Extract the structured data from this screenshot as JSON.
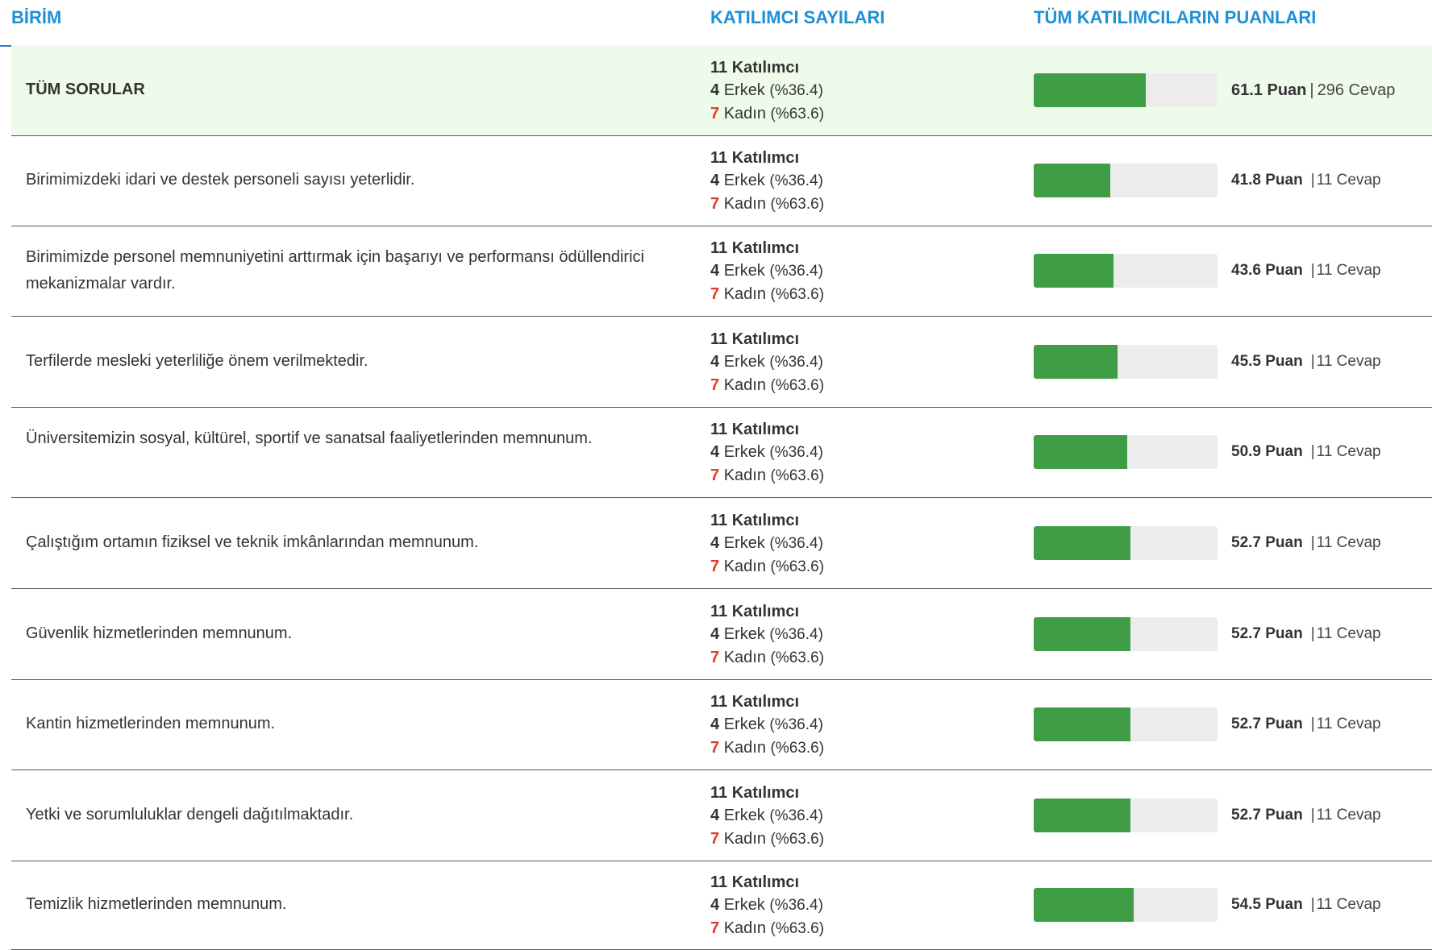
{
  "headers": {
    "birim": "BİRİM",
    "katilimci": "KATILIMCI SAYILARI",
    "puan": "TÜM KATILIMCILARIN PUANLARI"
  },
  "rows": [
    {
      "question": "TÜM SORULAR",
      "participants": "11 Katılımcı",
      "male_count": "4",
      "male_label": "Erkek",
      "male_pct": "(%36.4)",
      "female_count": "7",
      "female_label": "Kadın",
      "female_pct": "(%63.6)",
      "score": "61.1 Puan",
      "answers": "296 Cevap",
      "score_value": 61.1
    },
    {
      "question": "Birimimizdeki idari ve destek personeli sayısı yeterlidir.",
      "participants": "11 Katılımcı",
      "male_count": "4",
      "male_label": "Erkek",
      "male_pct": "(%36.4)",
      "female_count": "7",
      "female_label": "Kadın",
      "female_pct": "(%63.6)",
      "score": "41.8 Puan",
      "answers": "11 Cevap",
      "score_value": 41.8
    },
    {
      "question": "Birimimizde personel memnuniyetini arttırmak için başarıyı ve performansı ödüllendirici mekanizmalar vardır.",
      "participants": "11 Katılımcı",
      "male_count": "4",
      "male_label": "Erkek",
      "male_pct": "(%36.4)",
      "female_count": "7",
      "female_label": "Kadın",
      "female_pct": "(%63.6)",
      "score": "43.6 Puan",
      "answers": "11 Cevap",
      "score_value": 43.6
    },
    {
      "question": "Terfilerde mesleki yeterliliğe önem verilmektedir.",
      "participants": "11 Katılımcı",
      "male_count": "4",
      "male_label": "Erkek",
      "male_pct": "(%36.4)",
      "female_count": "7",
      "female_label": "Kadın",
      "female_pct": "(%63.6)",
      "score": "45.5 Puan",
      "answers": "11 Cevap",
      "score_value": 45.5
    },
    {
      "question": "Üniversitemizin sosyal, kültürel, sportif ve sanatsal faaliyetlerinden memnunum.",
      "participants": "11 Katılımcı",
      "male_count": "4",
      "male_label": "Erkek",
      "male_pct": "(%36.4)",
      "female_count": "7",
      "female_label": "Kadın",
      "female_pct": "(%63.6)",
      "score": "50.9 Puan",
      "answers": "11 Cevap",
      "score_value": 50.9
    },
    {
      "question": "Çalıştığım ortamın fiziksel ve teknik imkânlarından memnunum.",
      "participants": "11 Katılımcı",
      "male_count": "4",
      "male_label": "Erkek",
      "male_pct": "(%36.4)",
      "female_count": "7",
      "female_label": "Kadın",
      "female_pct": "(%63.6)",
      "score": "52.7 Puan",
      "answers": "11 Cevap",
      "score_value": 52.7
    },
    {
      "question": "Güvenlik hizmetlerinden memnunum.",
      "participants": "11 Katılımcı",
      "male_count": "4",
      "male_label": "Erkek",
      "male_pct": "(%36.4)",
      "female_count": "7",
      "female_label": "Kadın",
      "female_pct": "(%63.6)",
      "score": "52.7 Puan",
      "answers": "11 Cevap",
      "score_value": 52.7
    },
    {
      "question": "Kantin hizmetlerinden memnunum.",
      "participants": "11 Katılımcı",
      "male_count": "4",
      "male_label": "Erkek",
      "male_pct": "(%36.4)",
      "female_count": "7",
      "female_label": "Kadın",
      "female_pct": "(%63.6)",
      "score": "52.7 Puan",
      "answers": "11 Cevap",
      "score_value": 52.7
    },
    {
      "question": "Yetki ve sorumluluklar dengeli dağıtılmaktadır.",
      "participants": "11 Katılımcı",
      "male_count": "4",
      "male_label": "Erkek",
      "male_pct": "(%36.4)",
      "female_count": "7",
      "female_label": "Kadın",
      "female_pct": "(%63.6)",
      "score": "52.7 Puan",
      "answers": "11 Cevap",
      "score_value": 52.7
    },
    {
      "question": "Temizlik hizmetlerinden memnunum.",
      "participants": "11 Katılımcı",
      "male_count": "4",
      "male_label": "Erkek",
      "male_pct": "(%36.4)",
      "female_count": "7",
      "female_label": "Kadın",
      "female_pct": "(%63.6)",
      "score": "54.5 Puan",
      "answers": "11 Cevap",
      "score_value": 54.5
    }
  ],
  "colors": {
    "header_blue": "#1e90d6",
    "bar_fill": "#3f9e45",
    "bar_track": "#ececec",
    "female_count": "#e23a2a",
    "summary_bg": "#effbea"
  }
}
